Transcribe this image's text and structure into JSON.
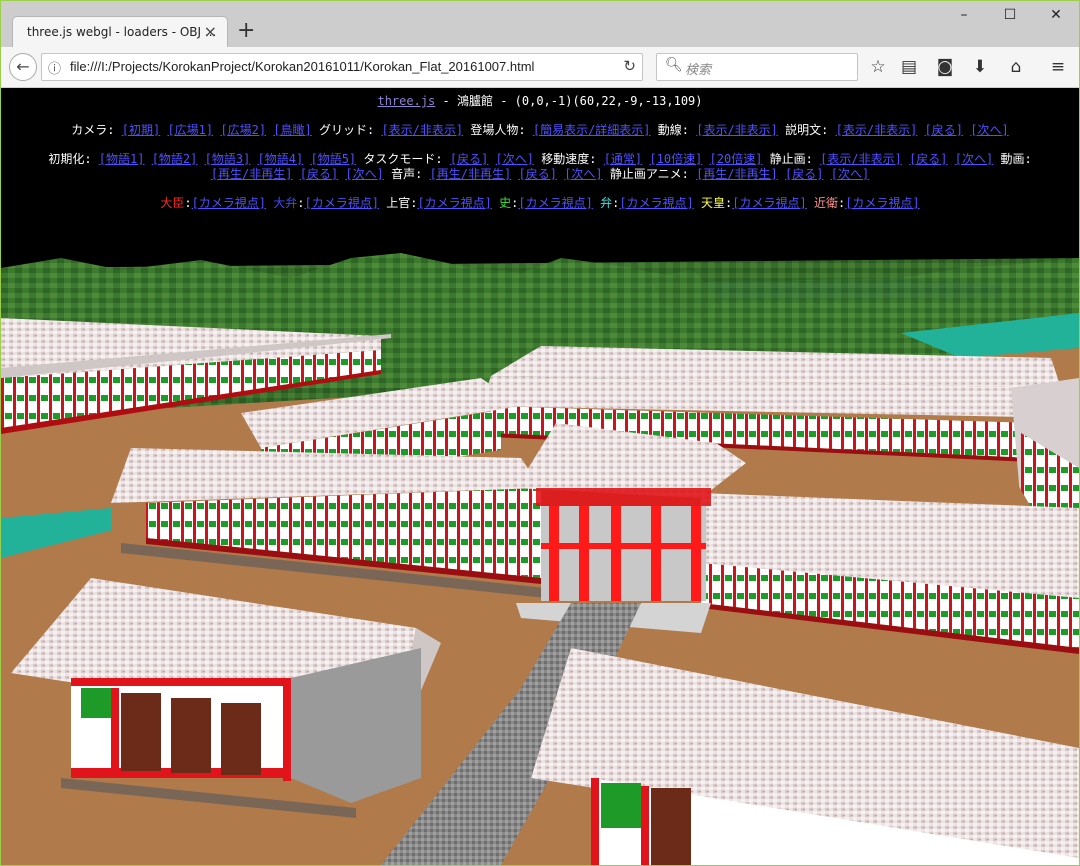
{
  "browser": {
    "tab_title": "three.js webgl - loaders - OBJ ...",
    "url": "file:///I:/Projects/KorokanProject/Korokan20161011/Korokan_Flat_20161007.html",
    "search_placeholder": "検索",
    "window_controls": [
      "–",
      "☐",
      "✕"
    ]
  },
  "page": {
    "header": {
      "link": "three.js",
      "sep": " - ",
      "title": "鴻臚館",
      "coords": " - (0,0,-1)(60,22,-9,-13,109)"
    },
    "row1": {
      "camera_label": "カメラ:",
      "camera": [
        "[初期]",
        "[広場1]",
        "[広場2]",
        "[鳥瞰]"
      ],
      "grid_label": "グリッド:",
      "grid": "[表示/非表示]",
      "people_label": "登場人物:",
      "people": "[簡易表示/詳細表示]",
      "path_label": "動線:",
      "path": "[表示/非表示]",
      "desc_label": "説明文:",
      "desc": [
        "[表示/非表示]",
        "[戻る]",
        "[次へ]"
      ]
    },
    "row2": {
      "init_label": "初期化:",
      "stories": [
        "[物語1]",
        "[物語2]",
        "[物語3]",
        "[物語4]",
        "[物語5]"
      ],
      "task_label": "タスクモード:",
      "task": [
        "[戻る]",
        "[次へ]"
      ],
      "speed_label": "移動速度:",
      "speed": [
        "[通常]",
        "[10倍速]",
        "[20倍速]"
      ],
      "still_label": "静止画:",
      "still": [
        "[表示/非表示]",
        "[戻る]",
        "[次へ]"
      ],
      "video_label": "動画:"
    },
    "row3": {
      "video": [
        "[再生/非再生]",
        "[戻る]",
        "[次へ]"
      ],
      "audio_label": "音声:",
      "audio": [
        "[再生/非再生]",
        "[戻る]",
        "[次へ]"
      ],
      "anim_label": "静止画アニメ:",
      "anim": [
        "[再生/非再生]",
        "[戻る]",
        "[次へ]"
      ]
    },
    "roles": [
      {
        "name": "大臣",
        "color": "#ff2a2a",
        "link": "[カメラ視点]"
      },
      {
        "name": "大弁",
        "color": "#3a4cff",
        "link": "[カメラ視点]"
      },
      {
        "name": "上官",
        "color": "#ffffff",
        "link": "[カメラ視点]"
      },
      {
        "name": "史",
        "color": "#44dd44",
        "link": "[カメラ視点]"
      },
      {
        "name": "弁",
        "color": "#40e0e0",
        "link": "[カメラ視点]"
      },
      {
        "name": "天皇",
        "color": "#ffff40",
        "link": "[カメラ視点]"
      },
      {
        "name": "近衛",
        "color": "#ff9090",
        "link": "[カメラ視点]"
      }
    ]
  },
  "colors": {
    "link": "#5050ff",
    "pillar_red": "#e0141a",
    "roof": "#e8e0e0",
    "wall": "#f0f0f0",
    "ground": "#b07a4a",
    "grass": "#3a7a2a",
    "water": "#22b29a",
    "sky": "#000000"
  },
  "icons": [
    "info-icon",
    "reload-icon",
    "search-icon",
    "bookmark-star-icon",
    "reader-icon",
    "pocket-icon",
    "download-icon",
    "home-icon",
    "menu-icon"
  ]
}
